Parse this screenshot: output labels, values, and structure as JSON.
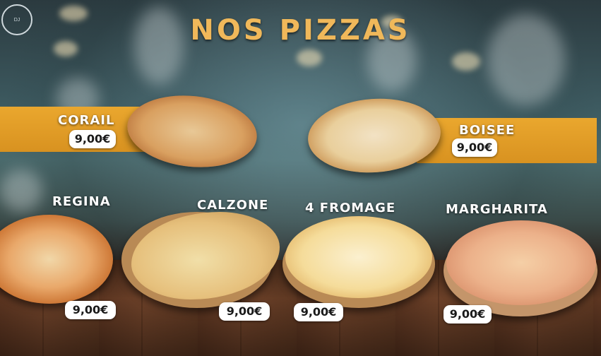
{
  "logo": {
    "text": "DJ"
  },
  "title": "NOS PIZZAS",
  "pizzas": [
    {
      "name": "CORAIL",
      "price": "9,00€"
    },
    {
      "name": "BOISEE",
      "price": "9,00€"
    },
    {
      "name": "REGINA",
      "price": "9,00€"
    },
    {
      "name": "CALZONE",
      "price": "9,00€"
    },
    {
      "name": "4 FROMAGE",
      "price": "9,00€"
    },
    {
      "name": "MARGHARITA",
      "price": "9,00€"
    }
  ],
  "colors": {
    "title": "#f0b85a",
    "band": "#e0a02a",
    "price_bg": "#ffffff"
  }
}
